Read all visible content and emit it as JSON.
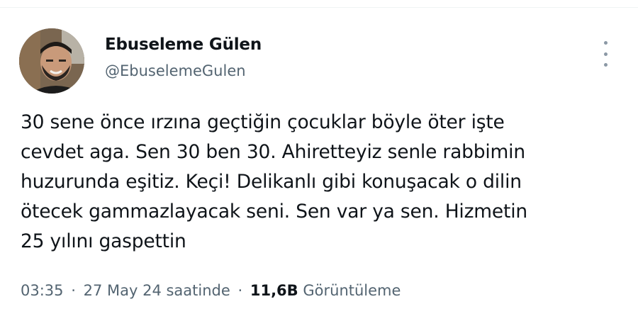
{
  "author": {
    "name": "Ebuseleme Gülen",
    "handle": "@EbuselemeGulen"
  },
  "tweet": {
    "text": "30 sene önce ırzına geçtiğin çocuklar böyle öter işte\ncevdet aga. Sen 30 ben 30. Ahiretteyiz senle rabbimin\nhuzurunda eşitiz. Keçi! Delikanlı gibi konuşacak o dilin\nötecek gammazlayacak seni. Sen var ya sen. Hizmetin\n25 yılını gaspettin"
  },
  "meta": {
    "time": "03:35",
    "separator": "·",
    "date": "27 May 24 saatinde",
    "views_count": "11,6B",
    "views_label": "Görüntüleme"
  },
  "icons": {
    "more": "more-vertical-icon"
  },
  "colors": {
    "text_primary": "#0f1419",
    "text_secondary": "#536471",
    "icon_gray": "#8b98a5",
    "background": "#ffffff"
  }
}
